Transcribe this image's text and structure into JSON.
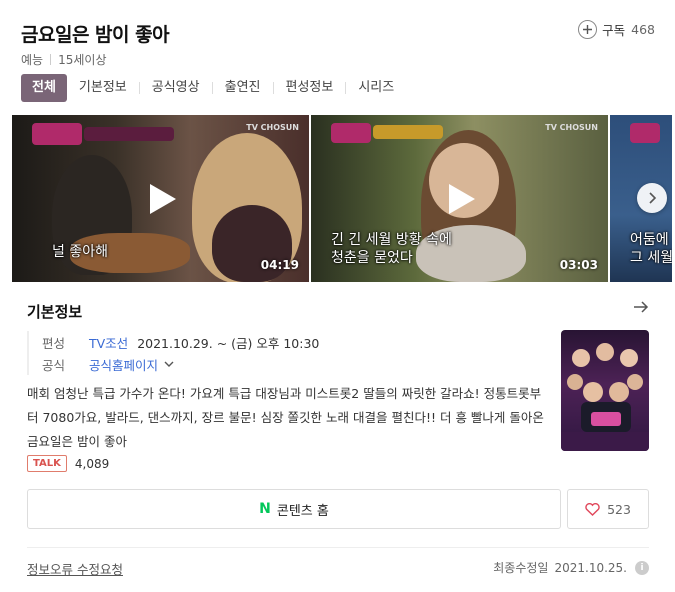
{
  "header": {
    "title": "금요일은 밤이 좋아",
    "genre": "예능",
    "rating": "15세이상",
    "subscribe_label": "구독",
    "subscribe_count": "468"
  },
  "tabs": [
    {
      "label": "전체",
      "active": true
    },
    {
      "label": "기본정보",
      "active": false
    },
    {
      "label": "공식영상",
      "active": false
    },
    {
      "label": "출연진",
      "active": false
    },
    {
      "label": "편성정보",
      "active": false
    },
    {
      "label": "시리즈",
      "active": false
    }
  ],
  "videos": [
    {
      "caption": "널 좋아해",
      "duration": "04:19",
      "channel": "TV CHOSUN"
    },
    {
      "caption_line1": "긴 긴 세월 방황 속에",
      "caption_line2": "청춘을 묻었다",
      "duration": "03:03",
      "channel": "TV CHOSUN"
    },
    {
      "caption_line1": "어둠에",
      "caption_line2": "그 세월"
    }
  ],
  "info": {
    "heading": "기본정보",
    "broadcast_key": "편성",
    "broadcast_channel": "TV조선",
    "broadcast_schedule": "2021.10.29. ~  (금) 오후 10:30",
    "official_key": "공식",
    "official_link": "공식홈페이지",
    "description": "매회 엄청난 특급 가수가 온다! 가요계 특급 대장님과 미스트롯2 딸들의 짜릿한 갈라쇼! 정통트롯부터 7080가요, 발라드, 댄스까지, 장르 불문! 심장 쫄깃한 노래 대결을 펼친다!! 더 흥 빨나게 돌아온 금요일은 밤이 좋아",
    "talk_label": "TALK",
    "talk_count": "4,089",
    "content_home_label": "콘텐츠 홈",
    "like_count": "523",
    "report_label": "정보오류 수정요청",
    "updated_label": "최종수정일",
    "updated_date": "2021.10.25."
  },
  "colors": {
    "active_tab": "#7a6577",
    "link": "#3a6ad4",
    "naver_green": "#03c75a",
    "heart": "#e0475b",
    "talk_badge": "#d9534f"
  },
  "icons": [
    "plus-icon",
    "play-icon",
    "chevron-right-icon",
    "arrow-right-icon",
    "chevron-down-icon",
    "naver-n-icon",
    "heart-icon",
    "info-icon"
  ]
}
